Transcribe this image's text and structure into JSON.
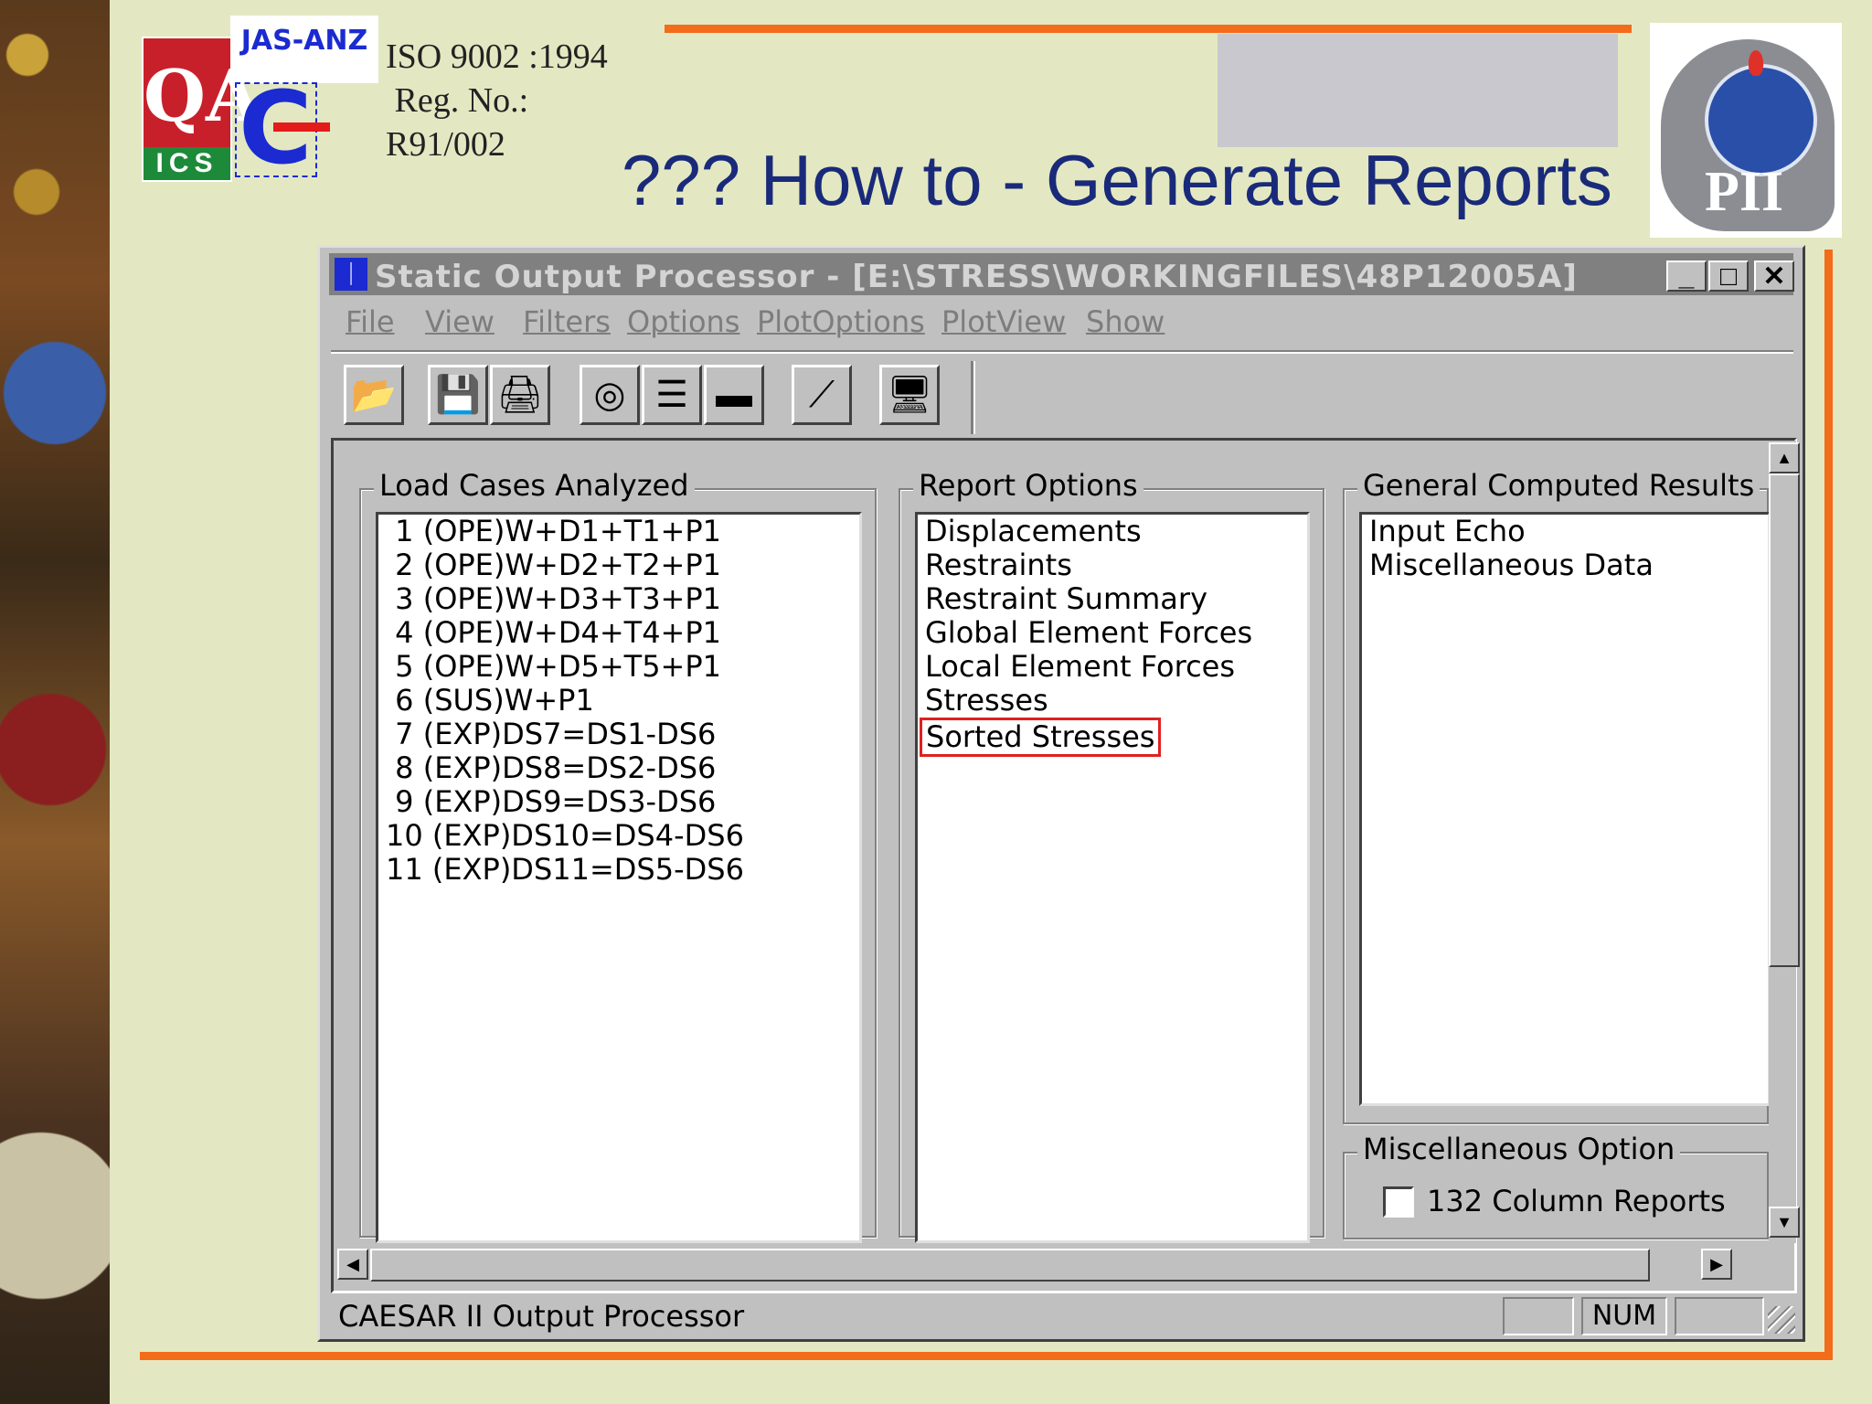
{
  "slide": {
    "iso_line1": "ISO 9002 :1994",
    "iso_line2": " Reg. No.:",
    "iso_line3": "R91/002",
    "title": "??? How to - Generate Reports",
    "logos": {
      "qa_text": "QA",
      "ics_text": "ICS",
      "jas_text": "JAS-ANZ",
      "pii_text": "PII"
    },
    "accent_color": "#f26c1a",
    "title_color": "#1a2a7a"
  },
  "window": {
    "title": "Static Output Processor - [E:\\STRESS\\WORKINGFILES\\48P12005A]",
    "controls": {
      "minimize": "_",
      "maximize": "□",
      "close": "✕"
    },
    "menu": [
      "File",
      "View",
      "Filters",
      "Options",
      "PlotOptions",
      "PlotView",
      "Show"
    ],
    "toolbar": [
      {
        "icon": "open-folder-icon",
        "glyph": "📂"
      },
      {
        "icon": "save-disk-icon",
        "glyph": "💾"
      },
      {
        "icon": "print-icon",
        "glyph": "🖨"
      },
      {
        "icon": "target-view-icon",
        "glyph": "◎"
      },
      {
        "icon": "report-view-icon",
        "glyph": "☰"
      },
      {
        "icon": "panel-view-icon",
        "glyph": "▬"
      },
      {
        "icon": "plot-zoom-icon",
        "glyph": "⟋"
      },
      {
        "icon": "monitor-icon",
        "glyph": "🖥"
      }
    ],
    "load_cases": {
      "label": "Load Cases Analyzed",
      "items": [
        " 1 (OPE)W+D1+T1+P1",
        " 2 (OPE)W+D2+T2+P1",
        " 3 (OPE)W+D3+T3+P1",
        " 4 (OPE)W+D4+T4+P1",
        " 5 (OPE)W+D5+T5+P1",
        " 6 (SUS)W+P1",
        " 7 (EXP)DS7=DS1-DS6",
        " 8 (EXP)DS8=DS2-DS6",
        " 9 (EXP)DS9=DS3-DS6",
        "10 (EXP)DS10=DS4-DS6",
        "11 (EXP)DS11=DS5-DS6"
      ]
    },
    "report_options": {
      "label": "Report Options",
      "items": [
        "Displacements",
        "Restraints",
        "Restraint Summary",
        "Global Element Forces",
        "Local Element Forces",
        "Stresses",
        "Sorted Stresses"
      ],
      "highlighted": "Sorted Stresses"
    },
    "general_results": {
      "label": "General Computed Results",
      "items": [
        "Input Echo",
        "Miscellaneous Data"
      ]
    },
    "misc_option": {
      "label": "Miscellaneous Option",
      "checkbox_label": "132 Column Reports",
      "checked": false
    },
    "status": {
      "text": "CAESAR II Output Processor",
      "pane1": "",
      "pane2": "NUM",
      "pane3": ""
    }
  }
}
